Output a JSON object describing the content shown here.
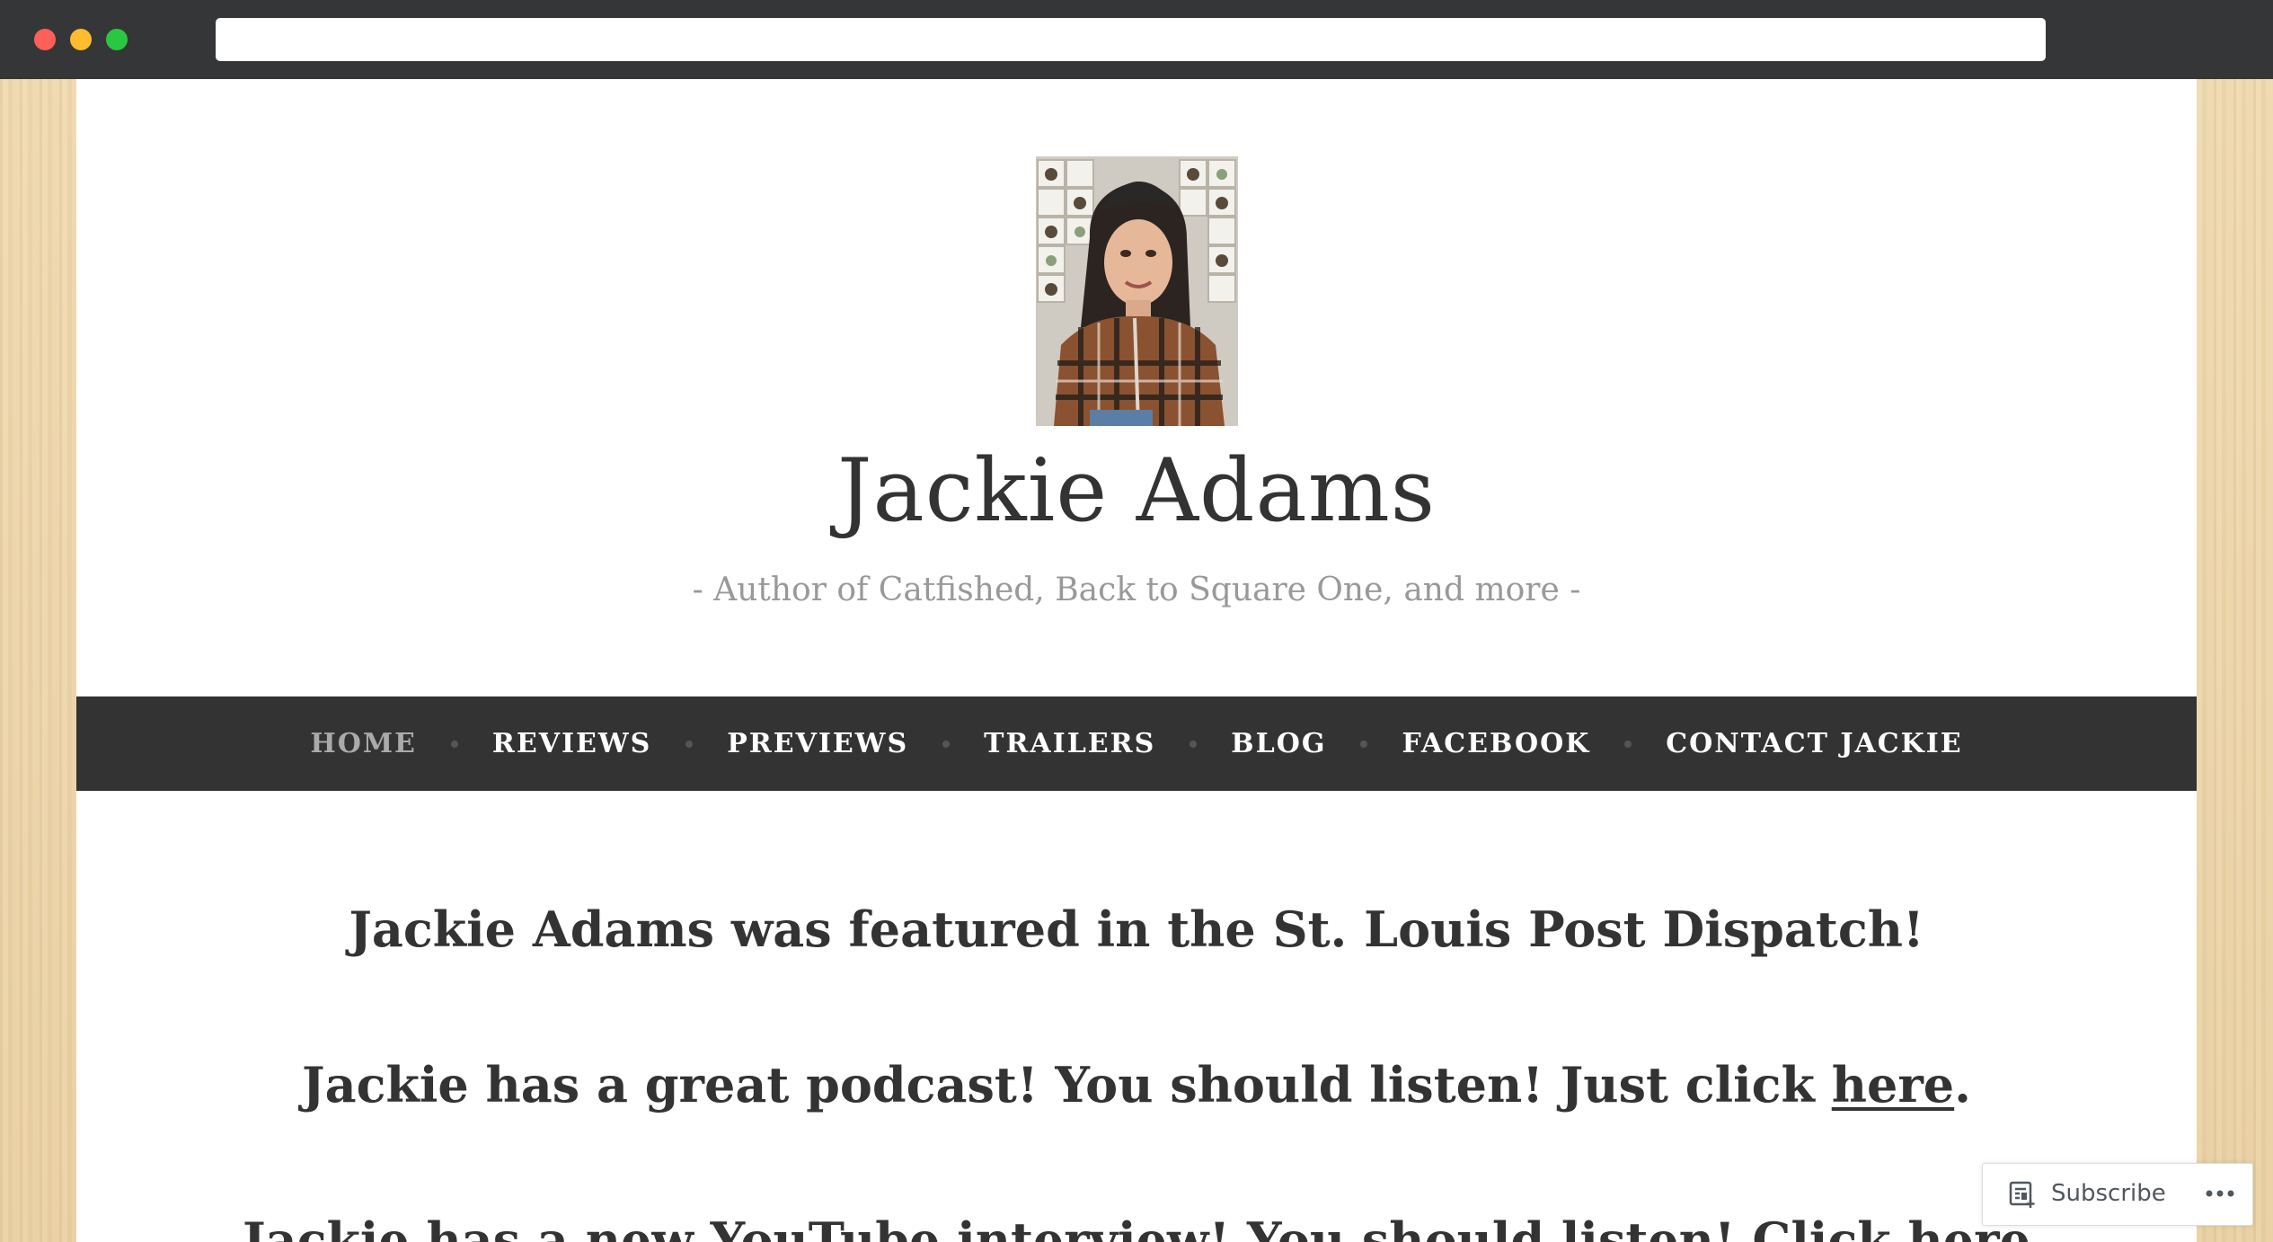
{
  "browser": {
    "url": ""
  },
  "site": {
    "title": "Jackie Adams",
    "tagline": "- Author of Catfished, Back to Square One, and more -"
  },
  "nav": {
    "items": [
      {
        "label": "HOME",
        "active": true
      },
      {
        "label": "REVIEWS"
      },
      {
        "label": "PREVIEWS"
      },
      {
        "label": "TRAILERS"
      },
      {
        "label": "BLOG"
      },
      {
        "label": "FACEBOOK"
      },
      {
        "label": "CONTACT JACKIE"
      }
    ]
  },
  "content": {
    "line1": "Jackie Adams was featured in the St. Louis Post Dispatch!",
    "line2_text": "Jackie has a great podcast! You should listen! Just click ",
    "line2_link": "here",
    "line2_end": ".",
    "line3_text": "Jackie has a new YouTube interview! You should listen! Click ",
    "line3_link": "here"
  },
  "subscribe": {
    "label": "Subscribe",
    "icon": "reader-subscribe-icon",
    "more_icon": "ellipsis-icon"
  },
  "colors": {
    "nav_bg": "#333333",
    "text": "#333333",
    "tagline": "#999999",
    "background_wood": "#e9d2a8"
  }
}
